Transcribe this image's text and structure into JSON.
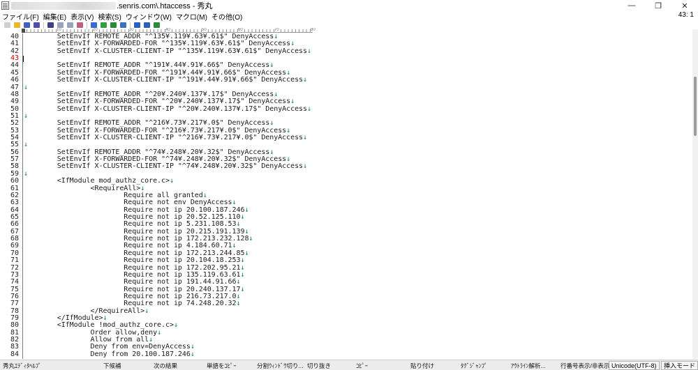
{
  "window": {
    "title": ".senris.com\\.htaccess - 秀丸",
    "controls": [
      "—",
      "❐",
      "✕"
    ]
  },
  "menubar": {
    "items": [
      "ファイル(F)",
      "編集(E)",
      "表示(V)",
      "検索(S)",
      "ウィンドウ(W)",
      "マクロ(M)",
      "その他(O)"
    ],
    "cursor_position": "43: 1"
  },
  "toolbar": {
    "icons": [
      "new-file-icon",
      "open-folder-icon",
      "save-icon",
      "save-all-icon",
      "undo-icon",
      "copy-icon",
      "cut-icon",
      "paste-icon",
      "find-icon",
      "find-prev-icon",
      "find-next-icon",
      "grep-icon",
      "window-icon",
      "split-icon",
      "macro-icon"
    ],
    "colors": [
      "#cfcfcf",
      "#e8b830",
      "#4060c0",
      "#5050a8",
      "#404080",
      "#9aa4b8",
      "#9aa4b8",
      "#c06080",
      "#3a6ad0",
      "#30a040",
      "#2a8a3a",
      "#4070b8",
      "#2a60c0",
      "#3060b0",
      "#2a8a3a"
    ]
  },
  "ruler": {
    "labels": [
      "10",
      "20",
      "30",
      "40",
      "50",
      "60",
      "70",
      "80"
    ]
  },
  "editor": {
    "current_line": "43",
    "lines": [
      {
        "n": "40",
        "text": "        SetEnvIf REMOTE_ADDR \"^135¥.119¥.63¥.61$\" DenyAccess",
        "nl": "↓"
      },
      {
        "n": "41",
        "text": "        SetEnvIf X-FORWARDED-FOR \"^135¥.119¥.63¥.61$\" DenyAccess",
        "nl": "↓"
      },
      {
        "n": "42",
        "text": "        SetEnvIf X-CLUSTER-CLIENT-IP \"^135¥.119¥.63¥.61$\" DenyAccess",
        "nl": "↓"
      },
      {
        "n": "43",
        "text": "",
        "nl": ""
      },
      {
        "n": "44",
        "text": "        SetEnvIf REMOTE_ADDR \"^191¥.44¥.91¥.66$\" DenyAccess",
        "nl": "↓"
      },
      {
        "n": "45",
        "text": "        SetEnvIf X-FORWARDED-FOR \"^191¥.44¥.91¥.66$\" DenyAccess",
        "nl": "↓"
      },
      {
        "n": "46",
        "text": "        SetEnvIf X-CLUSTER-CLIENT-IP \"^191¥.44¥.91¥.66$\" DenyAccess",
        "nl": "↓"
      },
      {
        "n": "47",
        "text": "",
        "nl": "↓"
      },
      {
        "n": "48",
        "text": "        SetEnvIf REMOTE_ADDR \"^20¥.240¥.137¥.17$\" DenyAccess",
        "nl": "↓"
      },
      {
        "n": "49",
        "text": "        SetEnvIf X-FORWARDED-FOR \"^20¥.240¥.137¥.17$\" DenyAccess",
        "nl": "↓"
      },
      {
        "n": "50",
        "text": "        SetEnvIf X-CLUSTER-CLIENT-IP \"^20¥.240¥.137¥.17$\" DenyAccess",
        "nl": "↓"
      },
      {
        "n": "51",
        "text": "",
        "nl": "↓"
      },
      {
        "n": "52",
        "text": "        SetEnvIf REMOTE_ADDR \"^216¥.73¥.217¥.0$\" DenyAccess",
        "nl": "↓"
      },
      {
        "n": "53",
        "text": "        SetEnvIf X-FORWARDED-FOR \"^216¥.73¥.217¥.0$\" DenyAccess",
        "nl": "↓"
      },
      {
        "n": "54",
        "text": "        SetEnvIf X-CLUSTER-CLIENT-IP \"^216¥.73¥.217¥.0$\" DenyAccess",
        "nl": "↓"
      },
      {
        "n": "55",
        "text": "",
        "nl": "↓"
      },
      {
        "n": "56",
        "text": "        SetEnvIf REMOTE_ADDR \"^74¥.248¥.20¥.32$\" DenyAccess",
        "nl": "↓"
      },
      {
        "n": "57",
        "text": "        SetEnvIf X-FORWARDED-FOR \"^74¥.248¥.20¥.32$\" DenyAccess",
        "nl": "↓"
      },
      {
        "n": "58",
        "text": "        SetEnvIf X-CLUSTER-CLIENT-IP \"^74¥.248¥.20¥.32$\" DenyAccess",
        "nl": "↓"
      },
      {
        "n": "59",
        "text": "",
        "nl": "↓"
      },
      {
        "n": "60",
        "text": "        <IfModule mod_authz_core.c>",
        "nl": "↓"
      },
      {
        "n": "61",
        "text": "                <RequireAll>",
        "nl": "↓"
      },
      {
        "n": "62",
        "text": "                        Require all granted",
        "nl": "↓"
      },
      {
        "n": "63",
        "text": "                        Require not env DenyAccess",
        "nl": "↓"
      },
      {
        "n": "64",
        "text": "                        Require not ip 20.100.187.246",
        "nl": "↓"
      },
      {
        "n": "65",
        "text": "                        Require not ip 20.52.125.110",
        "nl": "↓"
      },
      {
        "n": "66",
        "text": "                        Require not ip 5.231.108.53",
        "nl": "↓"
      },
      {
        "n": "67",
        "text": "                        Require not ip 20.215.191.139",
        "nl": "↓"
      },
      {
        "n": "68",
        "text": "                        Require not ip 172.213.232.128",
        "nl": "↓"
      },
      {
        "n": "69",
        "text": "                        Require not ip 4.184.60.71",
        "nl": "↓"
      },
      {
        "n": "70",
        "text": "                        Require not ip 172.213.244.85",
        "nl": "↓"
      },
      {
        "n": "71",
        "text": "                        Require not ip 20.104.18.253",
        "nl": "↓"
      },
      {
        "n": "72",
        "text": "                        Require not ip 172.202.95.21",
        "nl": "↓"
      },
      {
        "n": "73",
        "text": "                        Require not ip 135.119.63.61",
        "nl": "↓"
      },
      {
        "n": "74",
        "text": "                        Require not ip 191.44.91.66",
        "nl": "↓"
      },
      {
        "n": "75",
        "text": "                        Require not ip 20.240.137.17",
        "nl": "↓"
      },
      {
        "n": "76",
        "text": "                        Require not ip 216.73.217.0",
        "nl": "↓"
      },
      {
        "n": "77",
        "text": "                        Require not ip 74.248.20.32",
        "nl": "↓"
      },
      {
        "n": "78",
        "text": "                </RequireAll>",
        "nl": "↓"
      },
      {
        "n": "79",
        "text": "        </IfModule>",
        "nl": "↓"
      },
      {
        "n": "80",
        "text": "        <IfModule !mod_authz_core.c>",
        "nl": "↓"
      },
      {
        "n": "81",
        "text": "                Order allow,deny",
        "nl": "↓"
      },
      {
        "n": "82",
        "text": "                Allow from all",
        "nl": "↓"
      },
      {
        "n": "83",
        "text": "                Deny from env=DenyAccess",
        "nl": "↓"
      },
      {
        "n": "84",
        "text": "                Deny from 20.100.187.246",
        "nl": "↓"
      }
    ]
  },
  "function_keys": [
    {
      "label": "秀丸ｴﾃﾞｨﾀﾍﾙﾌﾟ"
    },
    {
      "label": "下候補"
    },
    {
      "label": "次の結果"
    },
    {
      "label": "単語をｺﾋﾟｰ"
    },
    {
      "label": "分割ｳｨﾝﾄﾞｳ切り..."
    },
    {
      "label": "切り抜き"
    },
    {
      "label": "ｺﾋﾟｰ"
    },
    {
      "label": "貼り付け"
    },
    {
      "label": "ﾀｸﾞｼﾞｬﾝﾌﾟ"
    },
    {
      "label": "ｱｳﾄﾗｲﾝ解析..."
    },
    {
      "label": "行番号表示/非表示"
    }
  ],
  "status": {
    "encoding": "Unicode(UTF-8)",
    "mode": "挿入モード"
  }
}
